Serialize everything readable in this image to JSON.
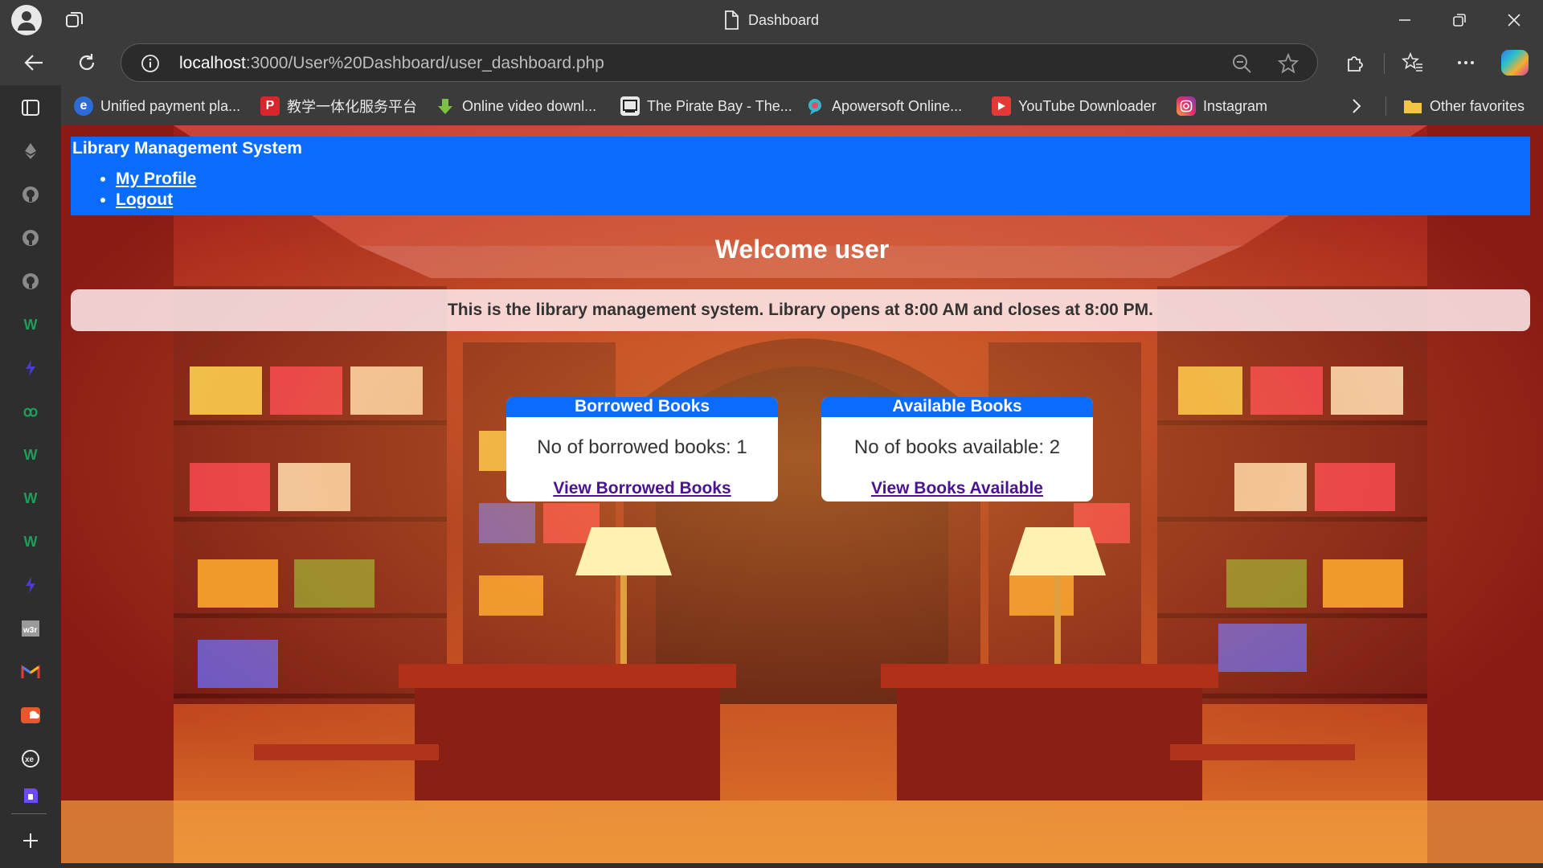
{
  "browser": {
    "window_title": "Dashboard",
    "url_host": "localhost",
    "url_rest": ":3000/User%20Dashboard/user_dashboard.php",
    "favorites": [
      {
        "label": "Unified payment pla...",
        "icon": "payment-icon"
      },
      {
        "label": "教学一体化服务平台",
        "icon": "p-icon"
      },
      {
        "label": "Online video downl...",
        "icon": "download-arrow-icon"
      },
      {
        "label": "The Pirate Bay - The...",
        "icon": "pirate-ship-icon"
      },
      {
        "label": "Apowersoft Online...",
        "icon": "apowersoft-icon"
      },
      {
        "label": "YouTube Downloader",
        "icon": "youtube-icon"
      },
      {
        "label": "Instagram",
        "icon": "instagram-icon"
      }
    ],
    "other_favorites": "Other favorites",
    "sidebar_icons": [
      "sidebar-panel-icon",
      "ethereum-icon",
      "github-icon",
      "github-icon",
      "github-icon",
      "w-icon",
      "lightning-icon",
      "chain-icon",
      "w-icon",
      "w-icon",
      "w-icon",
      "lightning-icon",
      "w3r-icon",
      "gmail-icon",
      "soundcloud-icon",
      "xe-icon",
      "proton-icon",
      "add-icon"
    ]
  },
  "site": {
    "title": "Library Management System",
    "nav": [
      "My Profile",
      "Logout"
    ],
    "welcome": "Welcome user",
    "info": "This is the library management system. Library opens at 8:00 AM and closes at 8:00 PM."
  },
  "cards": [
    {
      "title": "Borrowed Books",
      "count_text": "No of borrowed books: 1",
      "link": "View Borrowed Books"
    },
    {
      "title": "Available Books",
      "count_text": "No of books available: 2",
      "link": "View Books Available"
    }
  ],
  "colors": {
    "header_blue": "#0a6cff",
    "link_purple": "#4b148e",
    "browser_chrome": "#3b3b3b"
  }
}
